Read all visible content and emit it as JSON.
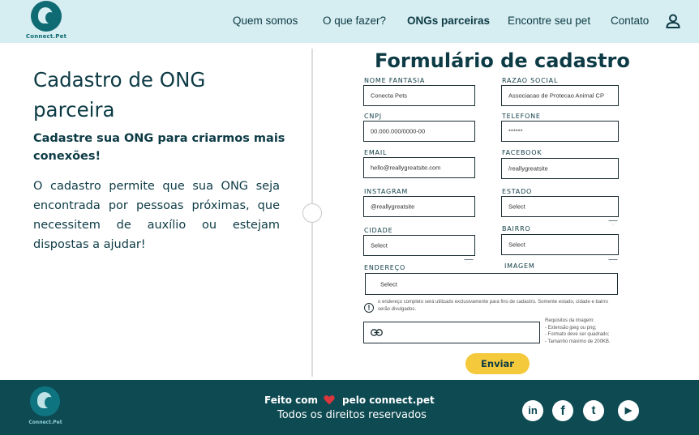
{
  "header": {
    "logo_text": "Connect.Pet",
    "nav": [
      {
        "label": "Quem somos"
      },
      {
        "label": "O que fazer?"
      },
      {
        "label": "ONGs parceiras"
      },
      {
        "label": "Encontre seu pet"
      },
      {
        "label": "Contato"
      }
    ],
    "active_nav": "ONGs parceiras",
    "user_icon": "user-icon"
  },
  "intro": {
    "title": "Cadastro de ONG parceira",
    "subtitle": "Cadastre sua ONG para criarmos mais conexões!",
    "body": "O cadastro permite que sua ONG seja encontrada por pessoas próximas, que necessitem de auxílio ou estejam dispostas a ajudar!"
  },
  "form": {
    "title": "Formulário de cadastro",
    "fields": {
      "nome_fantasia": {
        "label": "NOME FANTASIA",
        "value": "Conecta Pets"
      },
      "razao_social": {
        "label": "RAZAO SOCIAL",
        "value": "Associacao de Protecao Animal CP"
      },
      "cnpj": {
        "label": "CNPJ",
        "value": "00.000.000/0000-00"
      },
      "telefone": {
        "label": "TELEFONE",
        "value": "******"
      },
      "email": {
        "label": "EMAIL",
        "value": "hello@reallygreatsite.com"
      },
      "facebook": {
        "label": "FACEBOOK",
        "value": "/reallygreatsite"
      },
      "instagram": {
        "label": "INSTAGRAM",
        "value": "@reallygreatsite"
      },
      "estado": {
        "label": "ESTADO",
        "value": "Select"
      },
      "cidade": {
        "label": "CIDADE",
        "value": "Select"
      },
      "bairro": {
        "label": "BAIRRO",
        "value": "Select"
      },
      "endereco": {
        "label": "ENDEREÇO",
        "value": "Select"
      },
      "imagem": {
        "label": "IMAGEM"
      }
    },
    "address_note": "o endereço completo será utilizado exclusivamente para fins de cadastro. Somente estado, cidade e bairro serão divulgados.",
    "image_requirements": [
      "Requisitos da imagem:",
      "- Extensão jpeg ou png;",
      "- Formato deve ser quadrado;",
      "- Tamanho máximo de 200KB."
    ],
    "submit_label": "Enviar"
  },
  "footer": {
    "logo_text": "Connect.Pet",
    "made_with": "Feito com",
    "made_by": "pelo connect.pet",
    "rights": "Todos os direitos reservados",
    "social": [
      {
        "name": "linkedin-icon",
        "glyph": "in"
      },
      {
        "name": "facebook-icon",
        "glyph": "f"
      },
      {
        "name": "twitter-icon",
        "glyph": "t"
      },
      {
        "name": "youtube-icon",
        "glyph": "▶"
      }
    ]
  },
  "colors": {
    "header_bg": "#d6edf1",
    "footer_bg": "#0d4a52",
    "text": "#0d3b45",
    "button": "#f4c93b",
    "heart": "#d9363e"
  }
}
